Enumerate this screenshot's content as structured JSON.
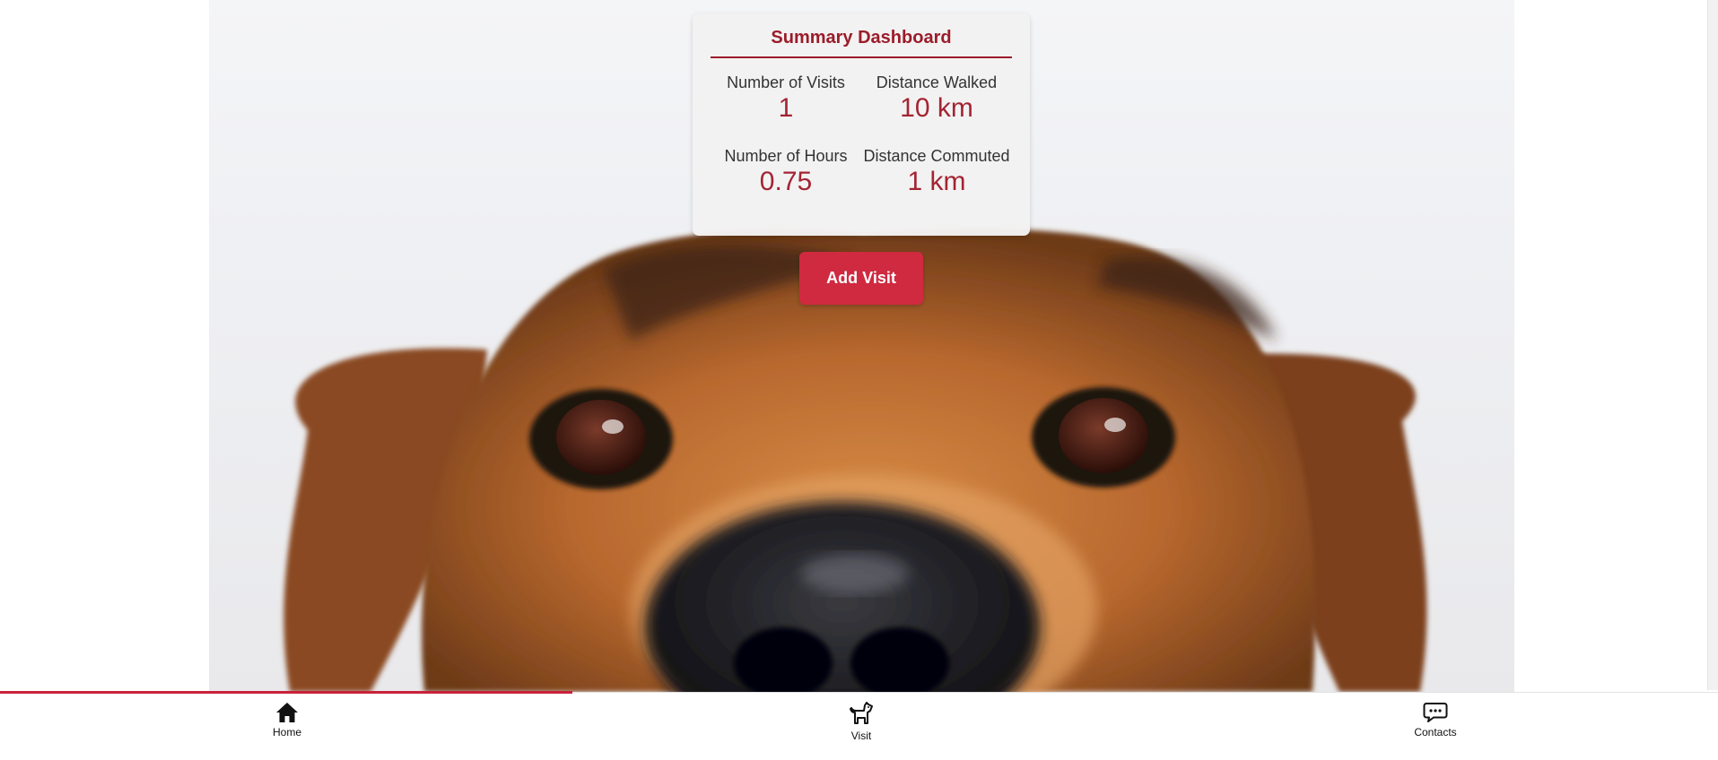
{
  "dashboard": {
    "title": "Summary Dashboard",
    "stats": [
      {
        "label": "Number of Visits",
        "value": "1"
      },
      {
        "label": "Distance Walked",
        "value": "10 km"
      },
      {
        "label": "Number of Hours",
        "value": "0.75"
      },
      {
        "label": "Distance Commuted",
        "value": "1 km"
      }
    ]
  },
  "actions": {
    "add_visit_label": "Add Visit"
  },
  "hero": {
    "icon": "dog-photo"
  },
  "bottom_nav": {
    "progress": 0.333,
    "items": [
      {
        "label": "Home",
        "icon": "home-icon"
      },
      {
        "label": "Visit",
        "icon": "dog-icon"
      },
      {
        "label": "Contacts",
        "icon": "chat-icon"
      }
    ]
  },
  "colors": {
    "accent": "#cf2a40",
    "title": "#9b1c2a",
    "value": "#a32433"
  }
}
